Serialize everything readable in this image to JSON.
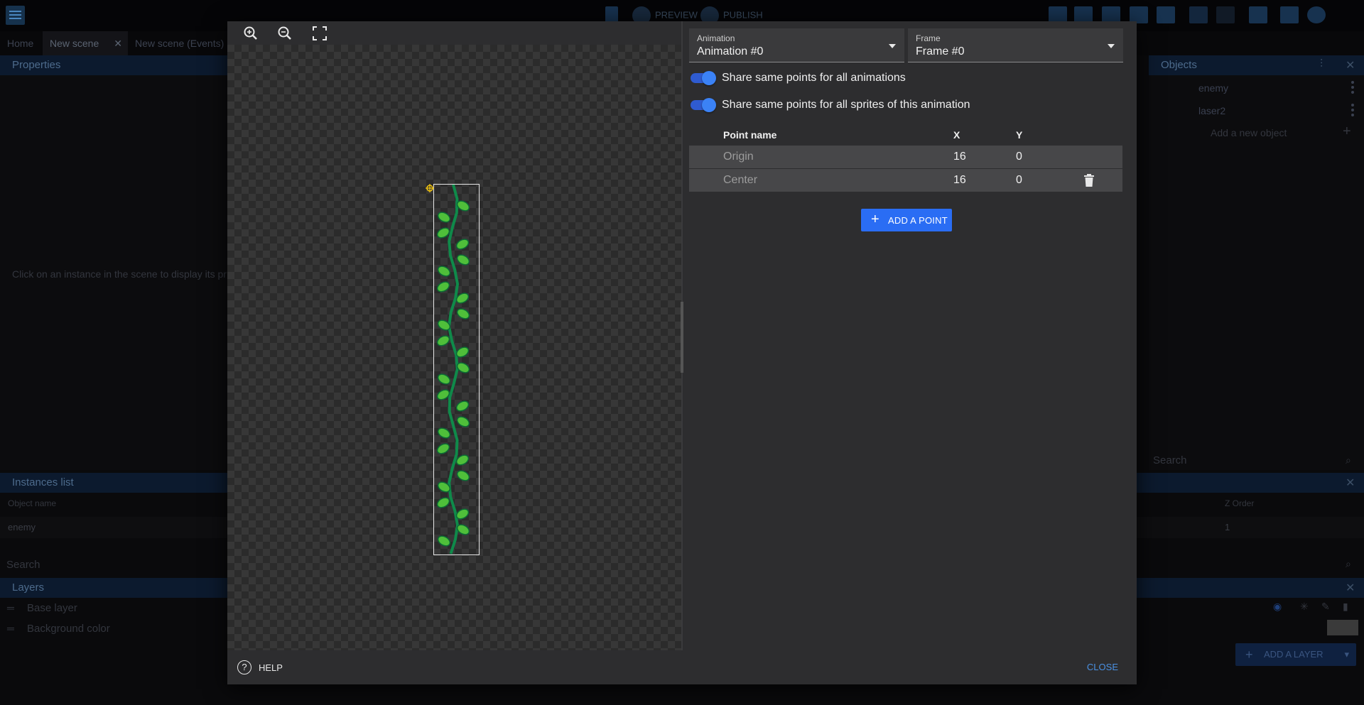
{
  "background": {
    "toolbar": {
      "preview_label": "PREVIEW",
      "publish_label": "PUBLISH"
    },
    "tabs": [
      {
        "label": "Home"
      },
      {
        "label": "New scene"
      },
      {
        "label": "New scene (Events)"
      }
    ],
    "properties": {
      "title": "Properties",
      "hint": "Click on an instance in the scene to display its pr"
    },
    "instances": {
      "title": "Instances list",
      "col_object_name": "Object name",
      "col_z_order": "Z Order",
      "row_name": "enemy",
      "row_z": "1",
      "search_placeholder": "Search"
    },
    "layers": {
      "title": "Layers",
      "items": [
        "Base layer",
        "Background color"
      ],
      "add_layer_label": "ADD A LAYER"
    },
    "objects": {
      "title": "Objects",
      "items": [
        "enemy",
        "laser2"
      ],
      "add_new_label": "Add a new object",
      "search_placeholder": "Search"
    }
  },
  "dialog": {
    "animation_select": {
      "label": "Animation",
      "value": "Animation #0"
    },
    "frame_select": {
      "label": "Frame",
      "value": "Frame #0"
    },
    "toggles": [
      {
        "label": "Share same points for all animations",
        "on": true
      },
      {
        "label": "Share same points for all sprites of this animation",
        "on": true
      }
    ],
    "table": {
      "col_name": "Point name",
      "col_x": "X",
      "col_y": "Y",
      "rows": [
        {
          "name": "Origin",
          "x": "16",
          "y": "0"
        },
        {
          "name": "Center",
          "x": "16",
          "y": "0"
        }
      ]
    },
    "add_point_label": "ADD A POINT",
    "help_label": "HELP",
    "close_label": "CLOSE"
  },
  "colors": {
    "accent": "#2a6df4",
    "link": "#4a90e2",
    "dialog_bg": "#2d2d2f"
  }
}
